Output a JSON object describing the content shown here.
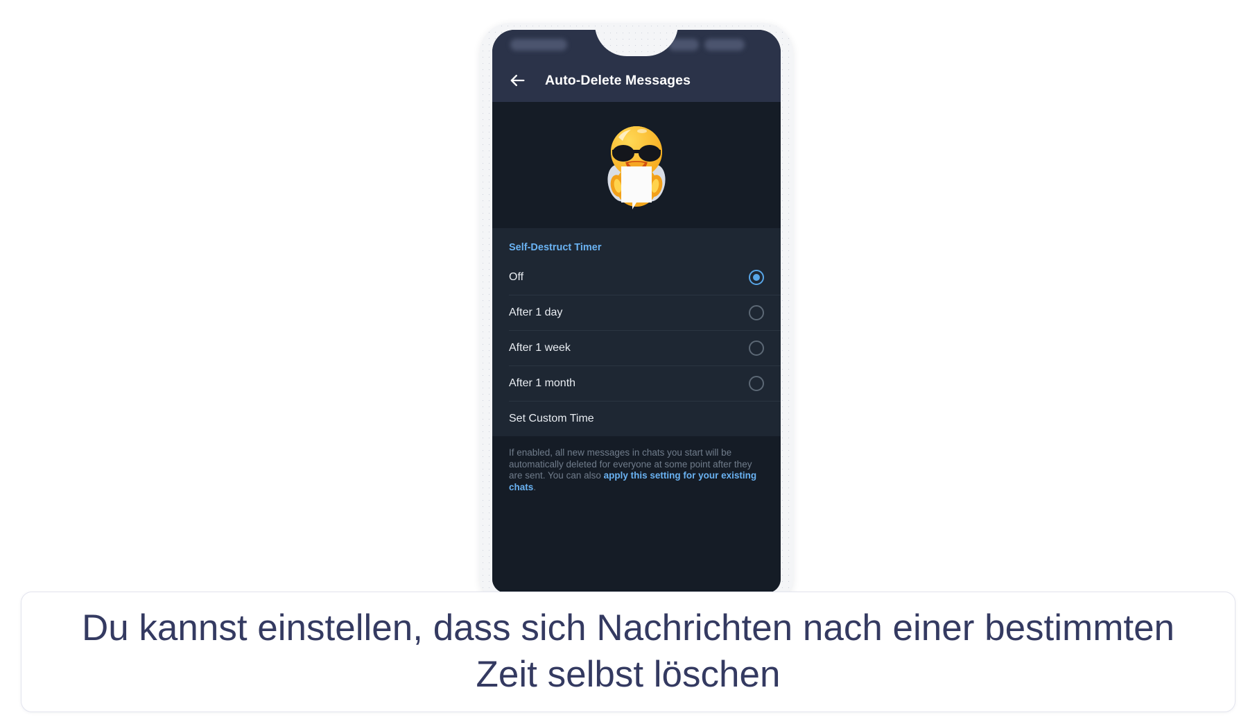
{
  "device": {
    "statusbar": {
      "left_pill": "signal-indicator",
      "right_pill_1": "battery-indicator",
      "right_pill_2": "wifi-indicator"
    }
  },
  "app": {
    "back_icon": "back-arrow-icon",
    "title": "Auto-Delete Messages",
    "sticker": "duck-with-sunglasses-holding-sheet-sticker"
  },
  "settings": {
    "section_title": "Self-Destruct Timer",
    "options": [
      {
        "label": "Off",
        "selected": true
      },
      {
        "label": "After 1 day",
        "selected": false
      },
      {
        "label": "After 1 week",
        "selected": false
      },
      {
        "label": "After 1 month",
        "selected": false
      }
    ],
    "custom_time_label": "Set Custom Time",
    "footer": {
      "text_before": "If enabled, all new messages in chats you start will be automatically deleted for everyone at some point after they are sent. You can also ",
      "link_text": "apply this setting for your existing chats",
      "text_after": "."
    }
  },
  "caption": {
    "text": "Du kannst einstellen, dass sich Nachrichten nach einer bestimmten Zeit selbst löschen"
  },
  "colors": {
    "accent_blue": "#6ab2f2",
    "radio_selected": "#58a6e8",
    "appbar_bg": "#2b3349",
    "screen_bg": "#151c26",
    "list_bg": "#1e2733",
    "caption_text": "#343a61"
  }
}
